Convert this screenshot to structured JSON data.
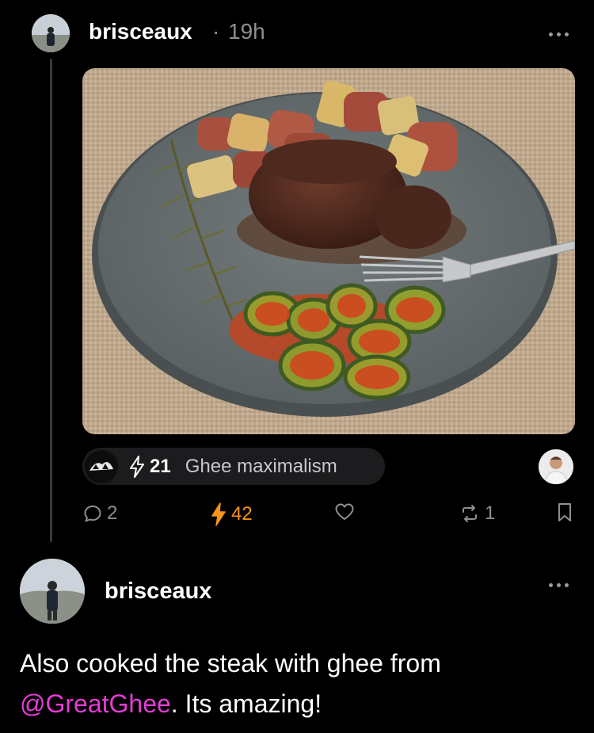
{
  "post": {
    "author": "brisceaux",
    "separator": "·",
    "time": "19h",
    "zap_pill": {
      "amount": "21",
      "message": "Ghee maximalism"
    },
    "actions": {
      "replies": "2",
      "zaps": "42",
      "reposts": "1"
    }
  },
  "reply": {
    "author": "brisceaux",
    "text_before": "Also cooked the steak with ghee from ",
    "mention": "@GreatGhee",
    "text_after": ".  Its amazing!"
  },
  "colors": {
    "background": "#000000",
    "zap_orange": "#f7931a",
    "mention_pink": "#e43cd6",
    "muted": "#8e8e93"
  },
  "icons": [
    "more-icon",
    "zap-icon",
    "reply-icon",
    "heart-icon",
    "repost-icon",
    "bookmark-icon"
  ]
}
